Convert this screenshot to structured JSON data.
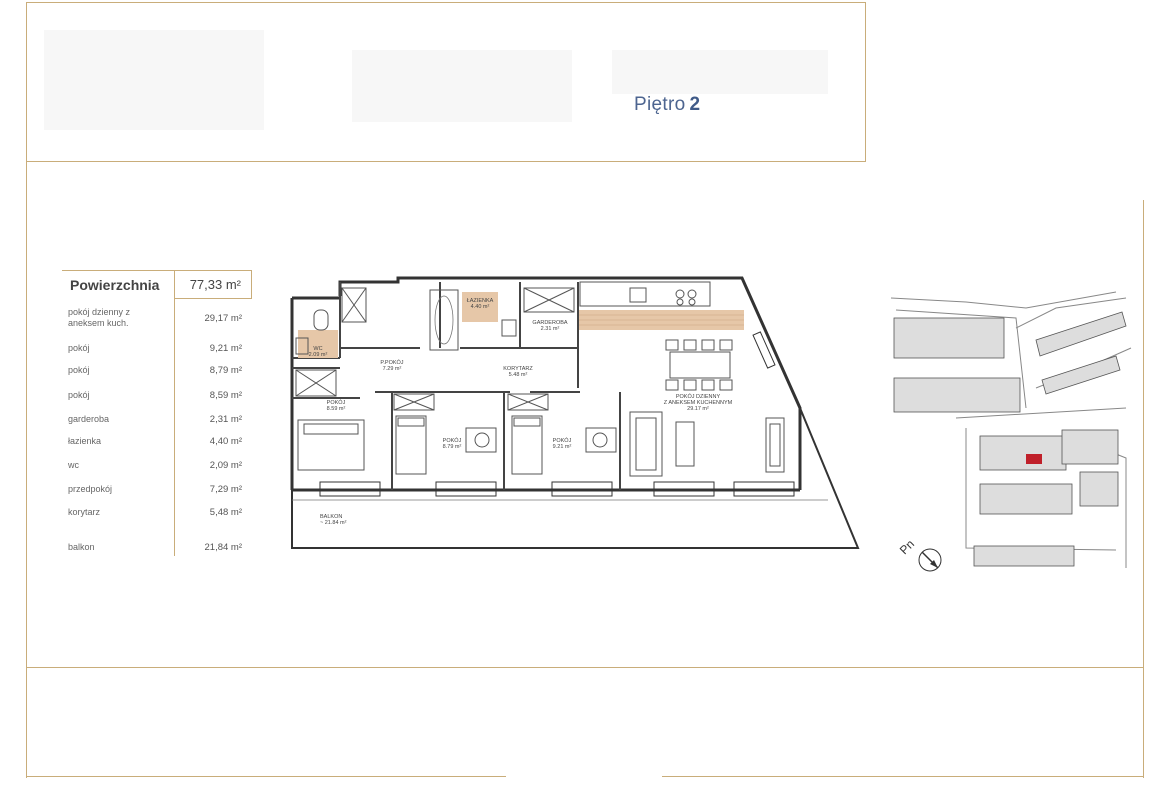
{
  "header": {
    "title_prefix": "Piętro",
    "floor_number": "2"
  },
  "area_table": {
    "title": "Powierzchnia",
    "total": "77,33 m²",
    "rows": [
      {
        "label": "pokój dzienny z aneksem kuch.",
        "value": "29,17 m²"
      },
      {
        "label": "pokój",
        "value": "9,21 m²"
      },
      {
        "label": "pokój",
        "value": "8,79 m²"
      },
      {
        "label": "pokój",
        "value": "8,59 m²"
      },
      {
        "label": "garderoba",
        "value": "2,31 m²"
      },
      {
        "label": "łazienka",
        "value": "4,40 m²"
      },
      {
        "label": "wc",
        "value": "2,09 m²"
      },
      {
        "label": "przedpokój",
        "value": "7,29 m²"
      },
      {
        "label": "korytarz",
        "value": "5,48 m²"
      },
      {
        "label": "balkon",
        "value": "21,84 m²"
      }
    ]
  },
  "floorplan": {
    "rooms": {
      "wc": {
        "name": "WC",
        "area": "2.09 m²"
      },
      "lazienka": {
        "name": "ŁAZIENKA",
        "area": "4.40 m²"
      },
      "garderoba": {
        "name": "GARDEROBA",
        "area": "2.31 m²"
      },
      "przedpokoj": {
        "name": "P.POKÓJ",
        "area": "7.29 m²"
      },
      "korytarz": {
        "name": "KORYTARZ",
        "area": "5.48 m²"
      },
      "pokoj_dzienny": {
        "name_line1": "POKÓJ DZIENNY",
        "name_line2": "Z ANEKSEM KUCHENNYM",
        "area": "29.17 m²"
      },
      "pokoj1": {
        "name": "POKÓJ",
        "area": "8.59 m²"
      },
      "pokoj2": {
        "name": "POKÓJ",
        "area": "8.79 m²"
      },
      "pokoj3": {
        "name": "POKÓJ",
        "area": "9.21 m²"
      },
      "balkon": {
        "name": "BALKON",
        "area": "~ 21.84 m²"
      }
    }
  },
  "site_map": {
    "north_label": "Pn"
  },
  "colors": {
    "gold_line": "#c9ad7a",
    "header_blue": "#4d6590",
    "highlight": "#c0202a",
    "tile": "#d9b99a"
  }
}
